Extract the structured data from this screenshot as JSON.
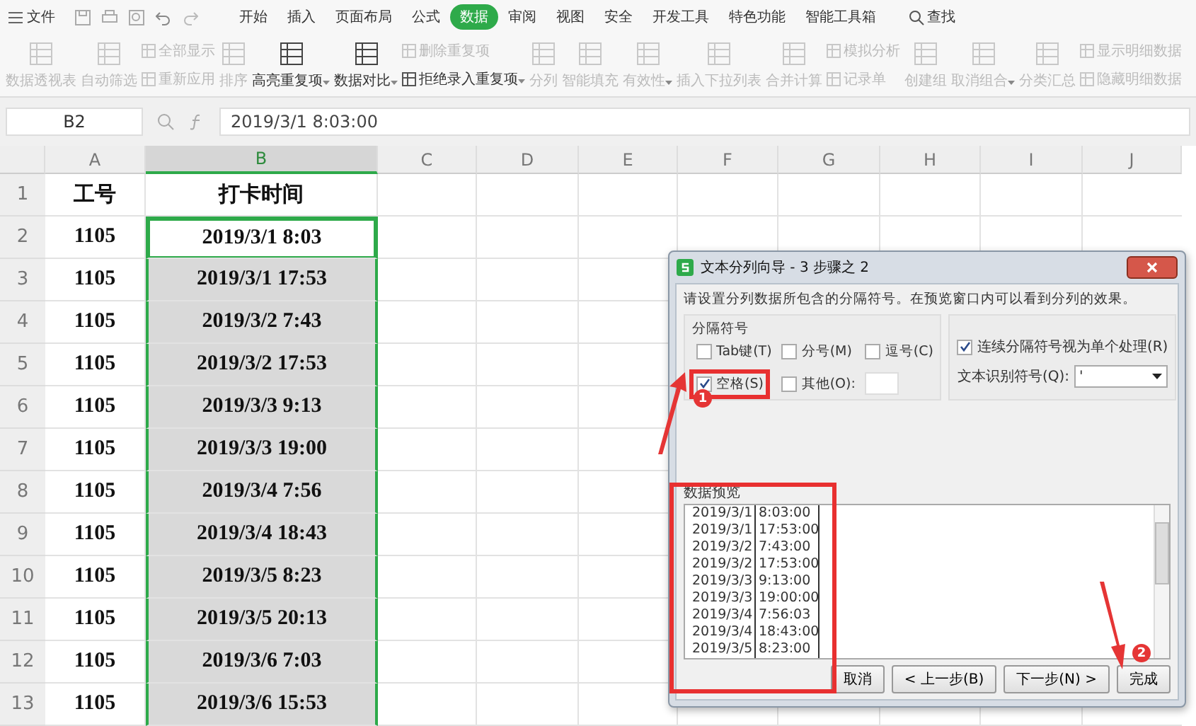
{
  "menu": {
    "file": "文件",
    "tabs": [
      {
        "label": "开始",
        "selected": false
      },
      {
        "label": "插入",
        "selected": false
      },
      {
        "label": "页面布局",
        "selected": false
      },
      {
        "label": "公式",
        "selected": false
      },
      {
        "label": "数据",
        "selected": true
      },
      {
        "label": "审阅",
        "selected": false
      },
      {
        "label": "视图",
        "selected": false
      },
      {
        "label": "安全",
        "selected": false
      },
      {
        "label": "开发工具",
        "selected": false
      },
      {
        "label": "特色功能",
        "selected": false
      },
      {
        "label": "智能工具箱",
        "selected": false
      }
    ],
    "search": "查找"
  },
  "ribbon": [
    [
      {
        "label": "数据透视表",
        "disabled": true,
        "dropdown": false
      }
    ],
    [
      {
        "label": "自动筛选",
        "disabled": true,
        "dropdown": false
      }
    ],
    [
      {
        "label": "全部显示",
        "disabled": true,
        "dropdown": false
      },
      {
        "label": "重新应用",
        "disabled": true,
        "dropdown": false
      }
    ],
    [
      {
        "label": "排序",
        "disabled": true,
        "dropdown": false
      }
    ],
    [
      {
        "label": "高亮重复项",
        "disabled": false,
        "dropdown": true
      }
    ],
    [
      {
        "label": "数据对比",
        "disabled": false,
        "dropdown": true
      }
    ],
    [
      {
        "label": "删除重复项",
        "disabled": true,
        "dropdown": false
      },
      {
        "label": "拒绝录入重复项",
        "disabled": false,
        "dropdown": true
      }
    ],
    [
      {
        "label": "分列",
        "disabled": true,
        "dropdown": false
      }
    ],
    [
      {
        "label": "智能填充",
        "disabled": true,
        "dropdown": false
      }
    ],
    [
      {
        "label": "有效性",
        "disabled": true,
        "dropdown": true
      }
    ],
    [
      {
        "label": "插入下拉列表",
        "disabled": true,
        "dropdown": false
      }
    ],
    [
      {
        "label": "合并计算",
        "disabled": true,
        "dropdown": false
      }
    ],
    [
      {
        "label": "模拟分析",
        "disabled": true,
        "dropdown": false
      },
      {
        "label": "记录单",
        "disabled": true,
        "dropdown": false
      }
    ],
    [
      {
        "label": "创建组",
        "disabled": true,
        "dropdown": false
      }
    ],
    [
      {
        "label": "取消组合",
        "disabled": true,
        "dropdown": true
      }
    ],
    [
      {
        "label": "分类汇总",
        "disabled": true,
        "dropdown": false
      }
    ],
    [
      {
        "label": "显示明细数据",
        "disabled": true,
        "dropdown": false
      },
      {
        "label": "隐藏明细数据",
        "disabled": true,
        "dropdown": false
      }
    ]
  ],
  "formula_bar": {
    "cell": "B2",
    "value": "2019/3/1 8:03:00"
  },
  "columns": [
    {
      "label": "A",
      "selected": false
    },
    {
      "label": "B",
      "selected": true
    },
    {
      "label": "C",
      "selected": false
    },
    {
      "label": "D",
      "selected": false
    },
    {
      "label": "E",
      "selected": false
    },
    {
      "label": "F",
      "selected": false
    },
    {
      "label": "G",
      "selected": false
    },
    {
      "label": "H",
      "selected": false
    },
    {
      "label": "I",
      "selected": false
    },
    {
      "label": "J",
      "selected": false
    }
  ],
  "rows": [
    {
      "number": "1",
      "id": "工号",
      "time": "打卡时间",
      "selected": false,
      "active": false
    },
    {
      "number": "2",
      "id": "1105",
      "time": "2019/3/1 8:03",
      "selected": true,
      "active": true
    },
    {
      "number": "3",
      "id": "1105",
      "time": "2019/3/1 17:53",
      "selected": true,
      "active": false
    },
    {
      "number": "4",
      "id": "1105",
      "time": "2019/3/2 7:43",
      "selected": true,
      "active": false
    },
    {
      "number": "5",
      "id": "1105",
      "time": "2019/3/2 17:53",
      "selected": true,
      "active": false
    },
    {
      "number": "6",
      "id": "1105",
      "time": "2019/3/3 9:13",
      "selected": true,
      "active": false
    },
    {
      "number": "7",
      "id": "1105",
      "time": "2019/3/3 19:00",
      "selected": true,
      "active": false
    },
    {
      "number": "8",
      "id": "1105",
      "time": "2019/3/4 7:56",
      "selected": true,
      "active": false
    },
    {
      "number": "9",
      "id": "1105",
      "time": "2019/3/4 18:43",
      "selected": true,
      "active": false
    },
    {
      "number": "10",
      "id": "1105",
      "time": "2019/3/5 8:23",
      "selected": true,
      "active": false
    },
    {
      "number": "11",
      "id": "1105",
      "time": "2019/3/5 20:13",
      "selected": true,
      "active": false
    },
    {
      "number": "12",
      "id": "1105",
      "time": "2019/3/6 7:03",
      "selected": true,
      "active": false
    },
    {
      "number": "13",
      "id": "1105",
      "time": "2019/3/6 15:53",
      "selected": true,
      "active": false
    }
  ],
  "dialog": {
    "title": "文本分列向导 - 3 步骤之 2",
    "instruction": "请设置分列数据所包含的分隔符号。在预览窗口内可以看到分列的效果。",
    "delimiters_label": "分隔符号",
    "delimiters": [
      {
        "label": "Tab键(T)",
        "checked": false,
        "highlighted": false
      },
      {
        "label": "分号(M)",
        "checked": false,
        "highlighted": false
      },
      {
        "label": "逗号(C)",
        "checked": false,
        "highlighted": false
      },
      {
        "label": "空格(S)",
        "checked": true,
        "highlighted": true
      },
      {
        "label": "其他(O):",
        "checked": false,
        "highlighted": false
      }
    ],
    "consecutive": {
      "label": "连续分隔符号视为单个处理(R)",
      "checked": true
    },
    "qualifier_label": "文本识别符号(Q):",
    "qualifier": "'",
    "preview_label": "数据预览",
    "preview": [
      [
        "2019/3/1",
        "8:03:00"
      ],
      [
        "2019/3/1",
        "17:53:00"
      ],
      [
        "2019/3/2",
        "7:43:00"
      ],
      [
        "2019/3/2",
        "17:53:00"
      ],
      [
        "2019/3/3",
        "9:13:00"
      ],
      [
        "2019/3/3",
        "19:00:00"
      ],
      [
        "2019/3/4",
        "7:56:03"
      ],
      [
        "2019/3/4",
        "18:43:00"
      ],
      [
        "2019/3/5",
        "8:23:00"
      ]
    ],
    "buttons": [
      "取消",
      "< 上一步(B)",
      "下一步(N) >",
      "完成"
    ]
  },
  "annotations": [
    "1",
    "2"
  ]
}
